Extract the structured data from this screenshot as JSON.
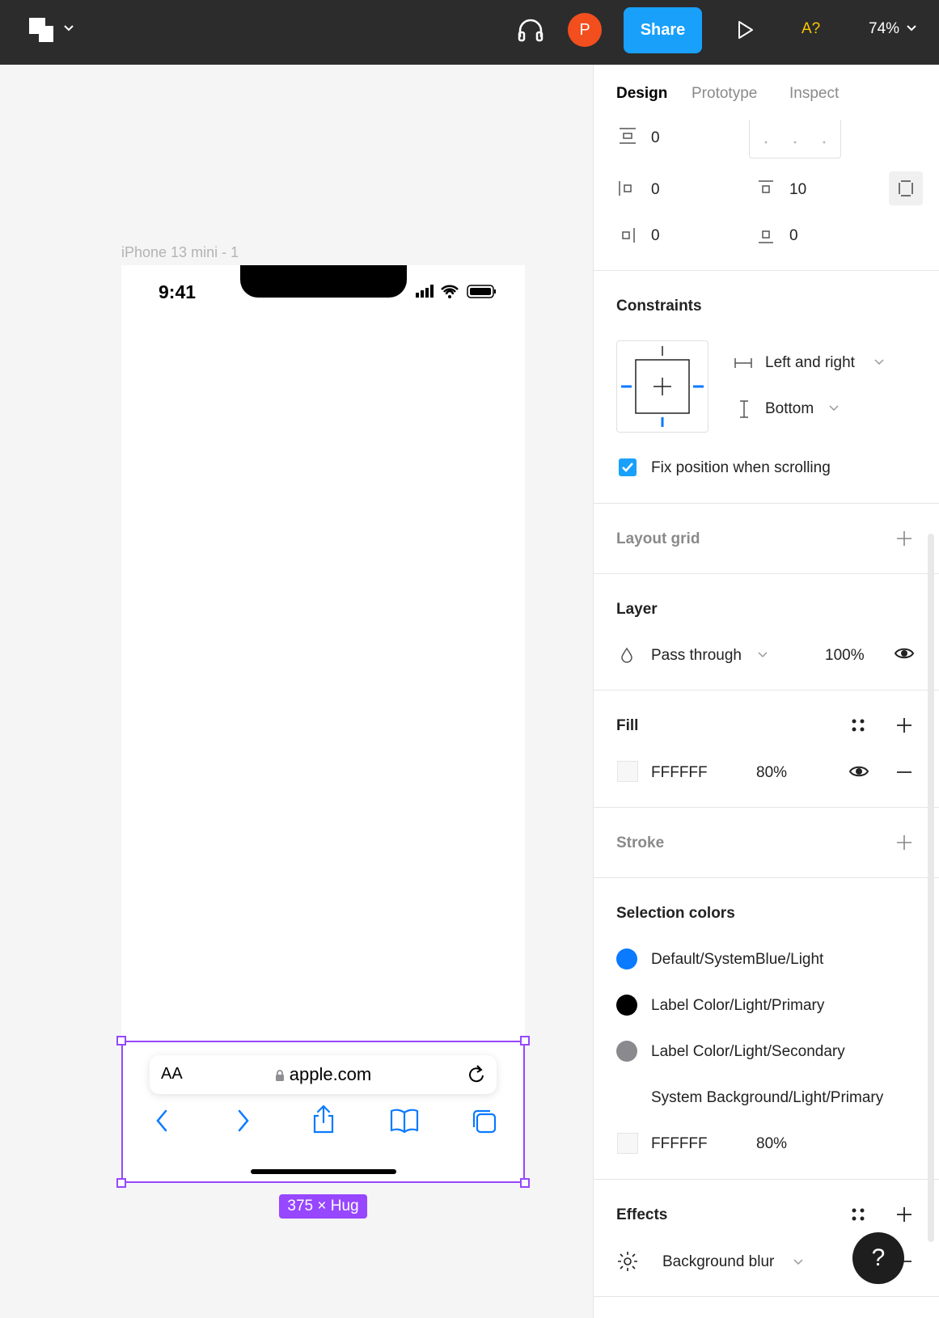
{
  "toolbar": {
    "avatar_initial": "P",
    "share_label": "Share",
    "font_warning": "A?",
    "zoom_label": "74%"
  },
  "canvas": {
    "frame_label": "iPhone 13 mini - 1",
    "status_time": "9:41",
    "url_text_size": "AA",
    "url": "apple.com",
    "size_label": "375 × Hug"
  },
  "panel": {
    "tabs": [
      "Design",
      "Prototype",
      "Inspect"
    ],
    "auto_layout": {
      "spacing": "0",
      "pad_left": "0",
      "pad_top": "10",
      "pad_right": "0",
      "pad_bottom": "0"
    },
    "constraints": {
      "title": "Constraints",
      "horizontal": "Left and right",
      "vertical": "Bottom",
      "fix_position_label": "Fix position when scrolling",
      "fix_position_checked": true
    },
    "layout_grid": {
      "title": "Layout grid"
    },
    "layer": {
      "title": "Layer",
      "blend_mode": "Pass through",
      "opacity": "100%"
    },
    "fill": {
      "title": "Fill",
      "hex": "FFFFFF",
      "opacity": "80%"
    },
    "stroke": {
      "title": "Stroke"
    },
    "selection_colors": {
      "title": "Selection colors",
      "items": [
        {
          "name": "Default/SystemBlue/Light",
          "color": "#0a7aff"
        },
        {
          "name": "Label Color/Light/Primary",
          "color": "#000000"
        },
        {
          "name": "Label Color/Light/Secondary",
          "color": "#8a8a8e"
        },
        {
          "name": "System Background/Light/Primary",
          "color": "#ffffff"
        }
      ],
      "extra_hex": "FFFFFF",
      "extra_opacity": "80%"
    },
    "effects": {
      "title": "Effects",
      "effect_name": "Background blur"
    }
  },
  "colors": {
    "accent": "#18a0fb",
    "selection": "#9747ff",
    "avatar": "#f24e1e",
    "ios_blue": "#0a7aff"
  }
}
